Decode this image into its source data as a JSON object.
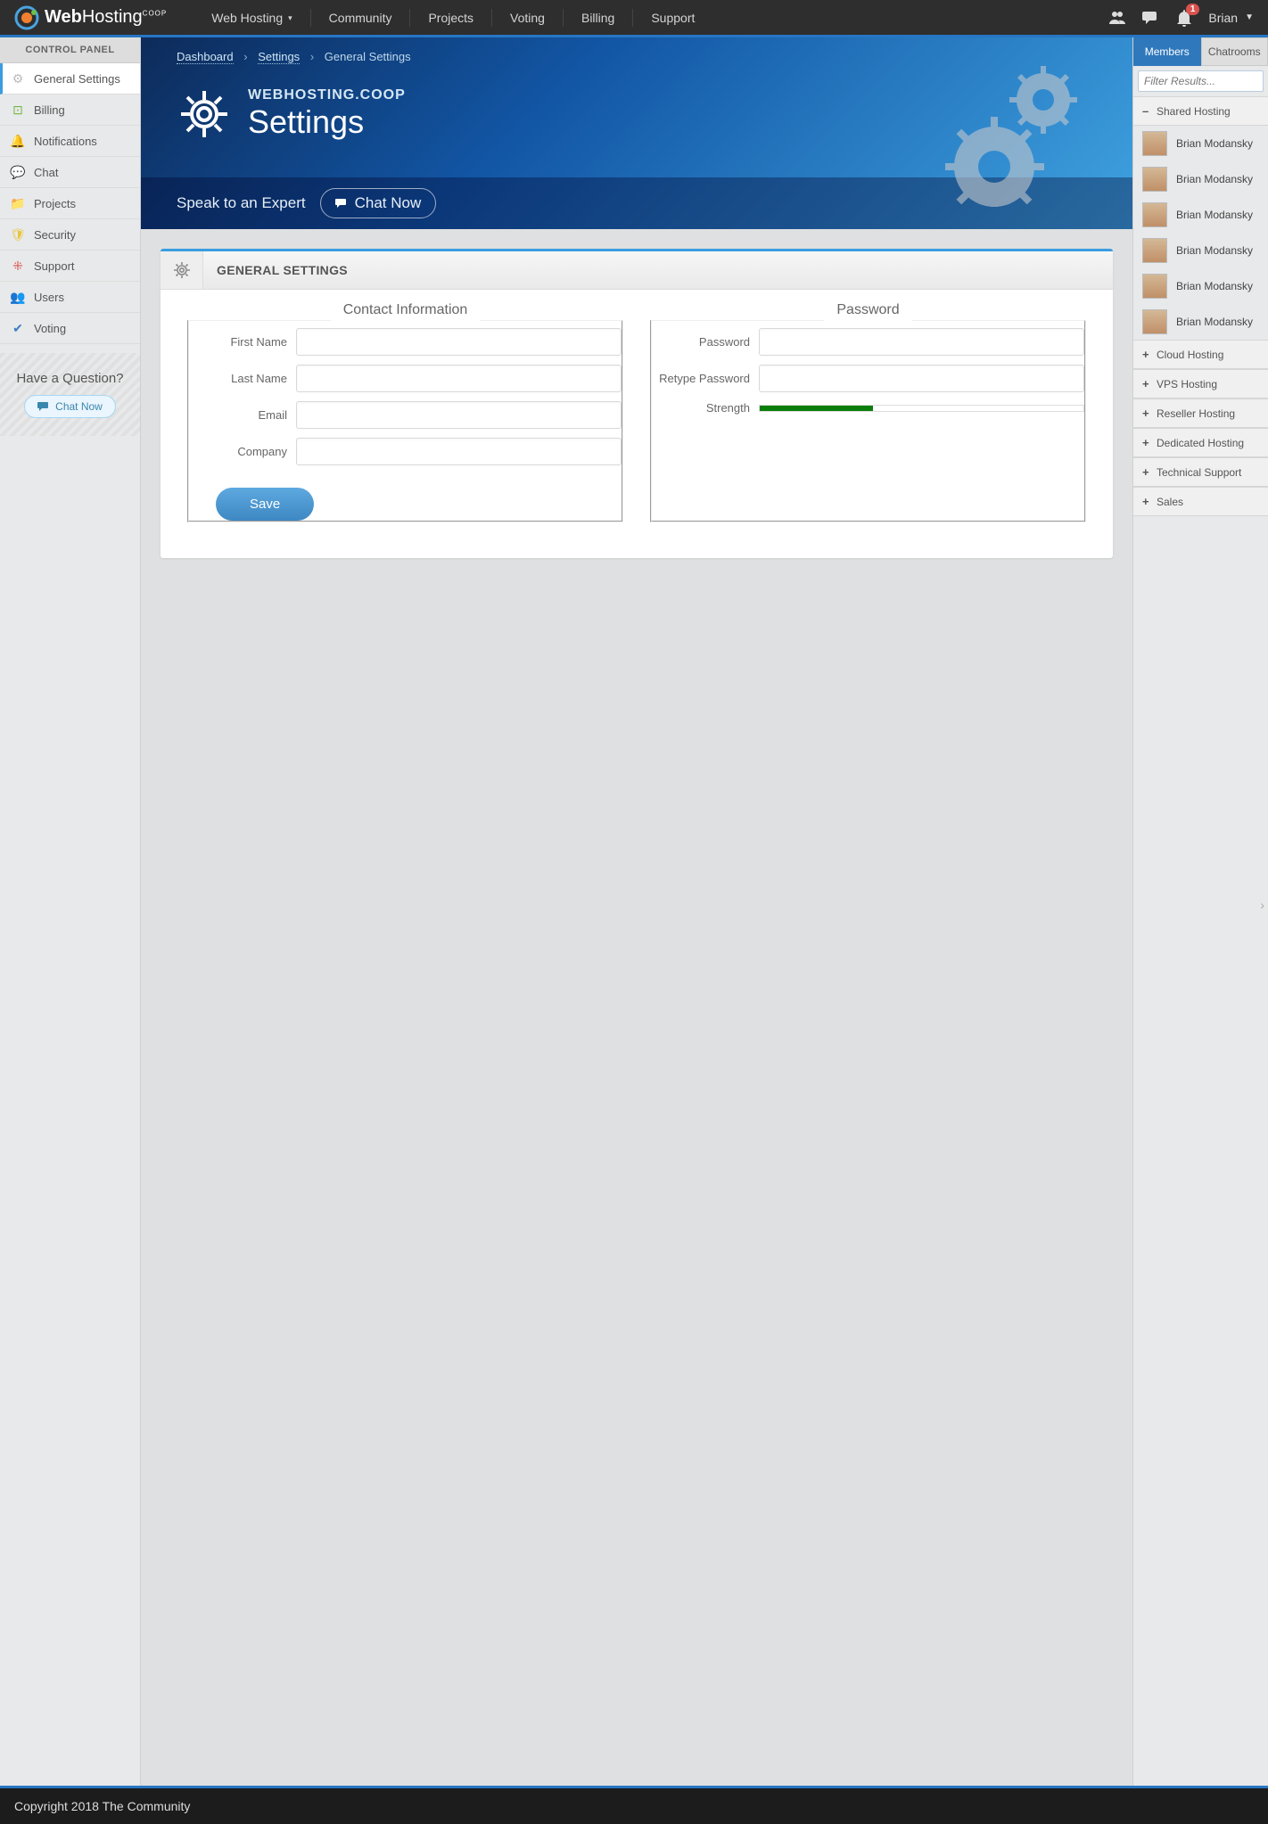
{
  "brand": {
    "name_a": "Web",
    "name_b": "Hosting",
    "name_sup": "COOP"
  },
  "topnav": [
    "Web Hosting",
    "Community",
    "Projects",
    "Voting",
    "Billing",
    "Support"
  ],
  "notif_count": "1",
  "username": "Brian",
  "sidebar": {
    "heading": "CONTROL PANEL",
    "items": [
      {
        "label": "General Settings",
        "icon": "⚙",
        "color": "#bbb"
      },
      {
        "label": "Billing",
        "icon": "⊡",
        "color": "#74b749"
      },
      {
        "label": "Notifications",
        "icon": "🔔",
        "color": "#f0b236"
      },
      {
        "label": "Chat",
        "icon": "💬",
        "color": "#2fa87b"
      },
      {
        "label": "Projects",
        "icon": "📁",
        "color": "#e9a03c"
      },
      {
        "label": "Security",
        "icon": "🛡",
        "color": "#e9c53c"
      },
      {
        "label": "Support",
        "icon": "⁜",
        "color": "#d9534f"
      },
      {
        "label": "Users",
        "icon": "👥",
        "color": "#7a7a7a"
      },
      {
        "label": "Voting",
        "icon": "✔",
        "color": "#3a7ec2"
      }
    ],
    "question": "Have a Question?",
    "chat": "Chat Now"
  },
  "crumbs": [
    "Dashboard",
    "Settings",
    "General Settings"
  ],
  "hero": {
    "brand": "WEBHOSTING.COOP",
    "title": "Settings"
  },
  "speak": {
    "text": "Speak to an Expert",
    "btn": "Chat Now"
  },
  "card": {
    "title": "GENERAL SETTINGS"
  },
  "form": {
    "contact_legend": "Contact Information",
    "password_legend": "Password",
    "labels": {
      "first": "First Name",
      "last": "Last Name",
      "email": "Email",
      "company": "Company",
      "pass": "Password",
      "retype": "Retype Password",
      "strength": "Strength"
    },
    "save": "Save"
  },
  "right": {
    "tabs": [
      "Members",
      "Chatrooms"
    ],
    "filter_placeholder": "Filter Results...",
    "groups": [
      {
        "name": "Shared Hosting",
        "open": true,
        "members": [
          "Brian Modansky",
          "Brian Modansky",
          "Brian Modansky",
          "Brian Modansky",
          "Brian Modansky",
          "Brian Modansky"
        ]
      },
      {
        "name": "Cloud Hosting",
        "open": false
      },
      {
        "name": "VPS Hosting",
        "open": false
      },
      {
        "name": "Reseller Hosting",
        "open": false
      },
      {
        "name": "Dedicated Hosting",
        "open": false
      },
      {
        "name": "Technical Support",
        "open": false
      },
      {
        "name": "Sales",
        "open": false
      }
    ]
  },
  "footer": "Copyright 2018 The Community"
}
